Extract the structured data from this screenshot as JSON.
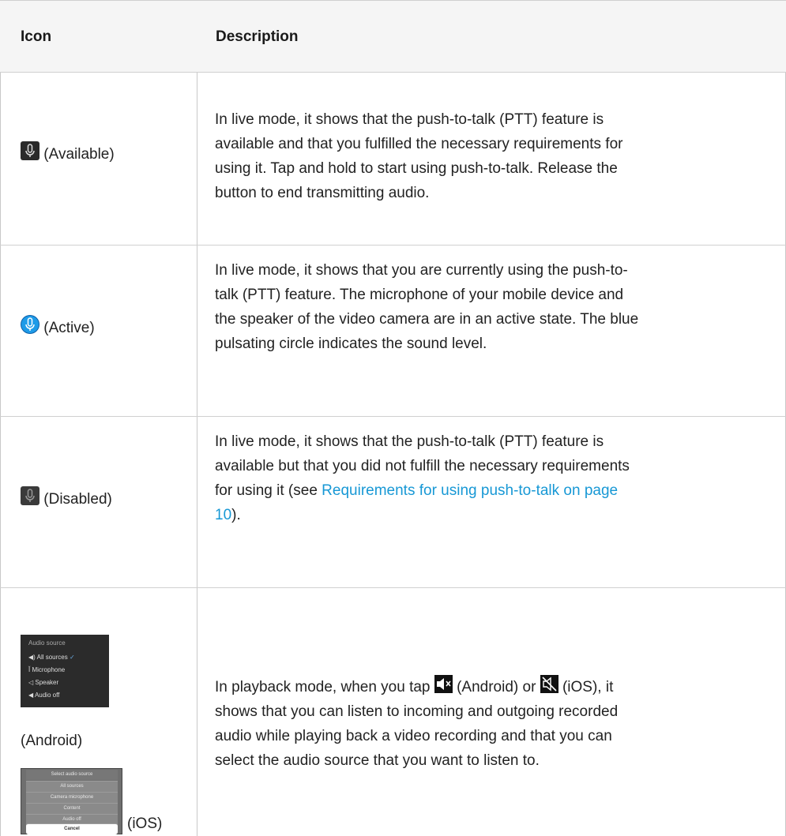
{
  "table": {
    "header": {
      "col_icon": "Icon",
      "col_description": "Description"
    },
    "rows": [
      {
        "icon_label": "(Available)",
        "icon_name": "microphone-available-icon",
        "description_lines": [
          "In live mode, it shows that the push-to-talk (PTT) feature is",
          "available and that you fulfilled the necessary requirements for",
          "using it. Tap and hold to start using push-to-talk. Release the",
          "button to end transmitting audio."
        ]
      },
      {
        "icon_label": "(Active)",
        "icon_name": "microphone-active-icon",
        "description_lines": [
          "In live mode, it shows that you are currently using the push-to-",
          "talk (PTT) feature. The microphone of your mobile device and",
          "the speaker of the video camera are in an active state. The blue",
          "pulsating circle indicates the sound level."
        ]
      },
      {
        "icon_label": "(Disabled)",
        "icon_name": "microphone-disabled-icon",
        "description_lines": [
          "In live mode, it shows that the push-to-talk (PTT) feature is",
          "available but that you did not fulfill the necessary requirements",
          "for using it (see "
        ],
        "link_text_line1": "Requirements for using push-to-talk on page",
        "link_text_line2": "10",
        "after_link": ")."
      },
      {
        "android_label": "(Android)",
        "ios_label": "(iOS)",
        "android_menu": {
          "title": "Audio source",
          "items": [
            "All sources",
            "Microphone",
            "Speaker",
            "Audio off"
          ]
        },
        "ios_menu": {
          "title": "Select audio source",
          "items": [
            "All sources",
            "Camera microphone",
            "Content",
            "Audio off"
          ],
          "cancel": "Cancel"
        },
        "description_part1": "In playback mode, when you tap ",
        "android_inline": "(Android) or ",
        "ios_inline": "(iOS), it",
        "description_lines": [
          "shows that you can listen to incoming and outgoing recorded",
          "audio while playing back a video recording and that you can",
          "select the audio source that you want to listen to."
        ]
      }
    ]
  },
  "colors": {
    "link": "#1798d5",
    "active_mic": "#1e9be8",
    "header_bg": "#f5f5f5"
  }
}
